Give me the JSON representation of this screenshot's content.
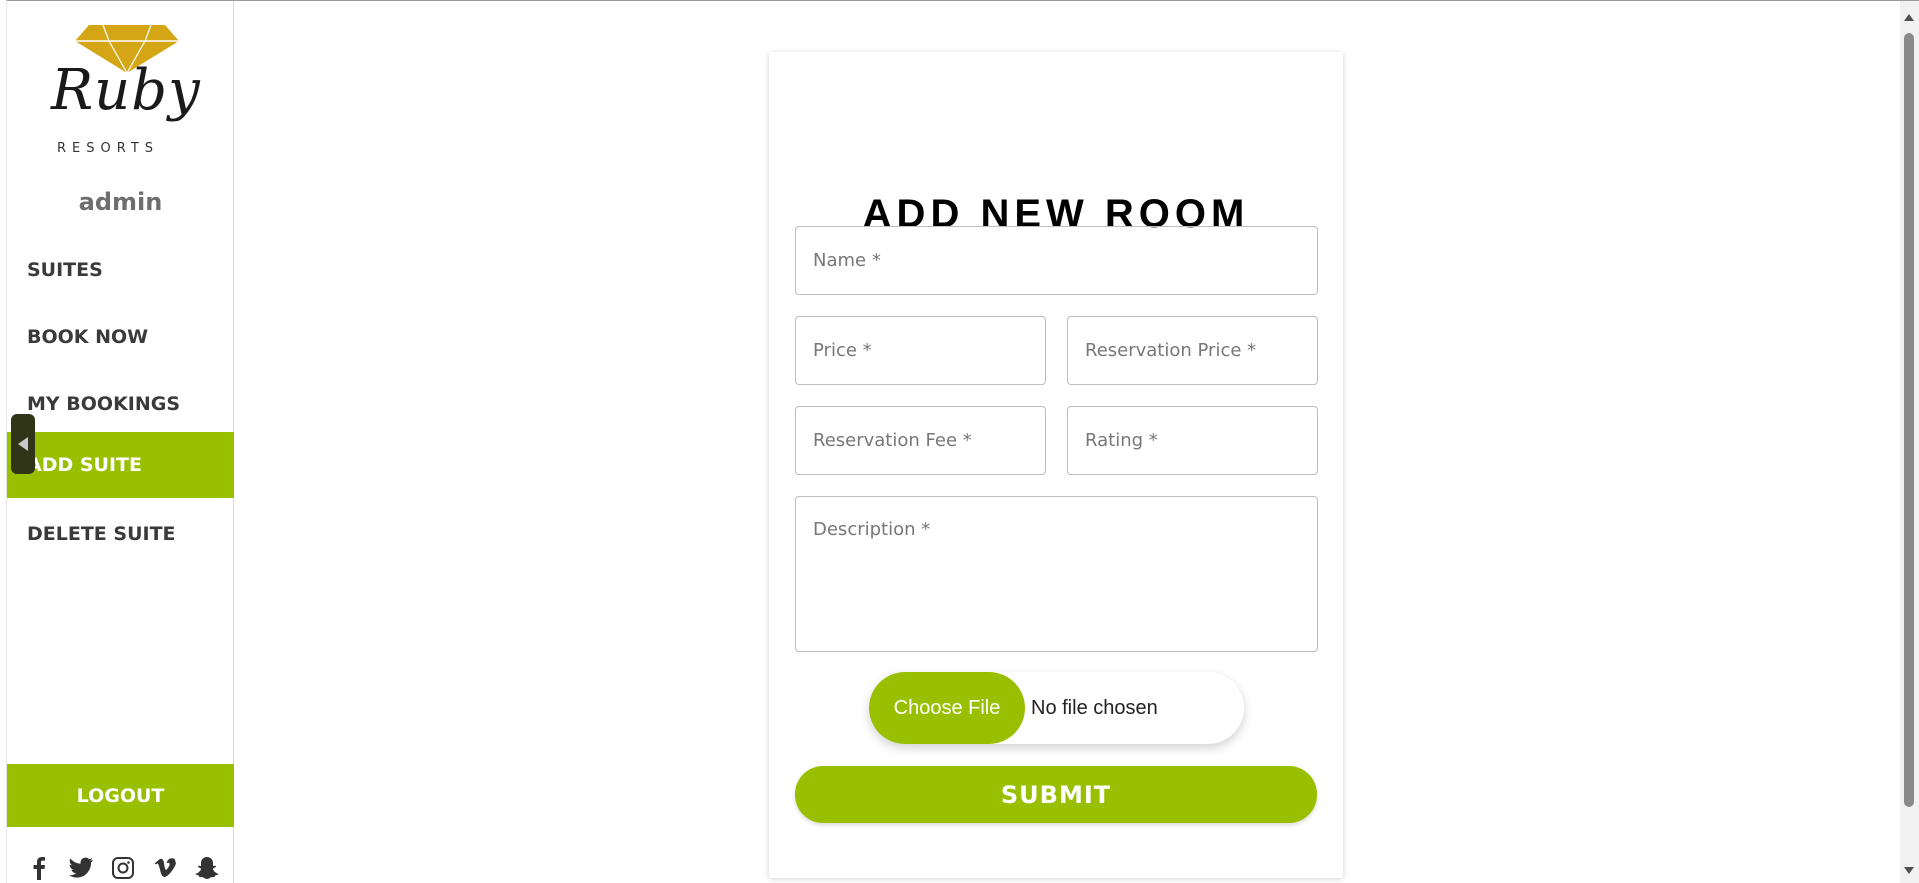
{
  "brand": {
    "logo_text": "Ruby",
    "logo_subtext": "RESORTS",
    "gem_color": "#d4a514"
  },
  "user": {
    "name": "admin"
  },
  "nav": {
    "items": [
      {
        "label": "SUITES",
        "active": false
      },
      {
        "label": "BOOK NOW",
        "active": false
      },
      {
        "label": "MY BOOKINGS",
        "active": false
      },
      {
        "label": "ADD SUITE",
        "active": true
      },
      {
        "label": "DELETE SUITE",
        "active": false
      }
    ],
    "logout_label": "LOGOUT"
  },
  "socials": [
    "facebook-icon",
    "twitter-icon",
    "instagram-icon",
    "vimeo-icon",
    "snapchat-icon"
  ],
  "form": {
    "title": "ADD NEW ROOM",
    "fields": {
      "name": "Name *",
      "price": "Price *",
      "reservation_price": "Reservation Price *",
      "reservation_fee": "Reservation Fee *",
      "rating": "Rating *",
      "description": "Description *"
    },
    "file": {
      "button_label": "Choose File",
      "status": "No file chosen"
    },
    "submit_label": "SUBMIT"
  },
  "colors": {
    "accent": "#99c000",
    "handle": "#2f3516"
  }
}
